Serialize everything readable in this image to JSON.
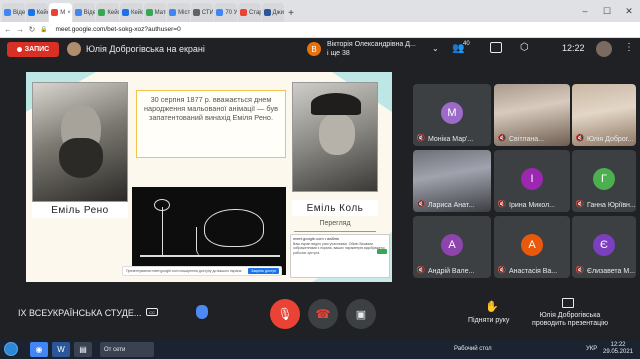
{
  "browser": {
    "tabs": [
      {
        "label": "Відео",
        "color": "#4285f4"
      },
      {
        "label": "Кейс",
        "color": "#1a73e8"
      },
      {
        "label": "M",
        "color": "#ea4335",
        "active": true
      },
      {
        "label": "Відео",
        "color": "#4285f4"
      },
      {
        "label": "Кейс",
        "color": "#34a853"
      },
      {
        "label": "Кейс",
        "color": "#1a73e8"
      },
      {
        "label": "Мате",
        "color": "#34a853"
      },
      {
        "label": "Місті",
        "color": "#4285f4"
      },
      {
        "label": "СТИ",
        "color": "#5f6368"
      },
      {
        "label": "70 У",
        "color": "#4285f4"
      },
      {
        "label": "Старі",
        "color": "#ea4335"
      },
      {
        "label": "Джи",
        "color": "#2b579a"
      }
    ],
    "url": "meet.google.com/bet-sokg-xoz?authuser=0"
  },
  "meet_header": {
    "recording_label": "ЗАПИС",
    "presenter_title": "Юлія Доброгівська на екрані",
    "notification_initial": "В",
    "notification_line1": "Вікторія Олександрівна Д...",
    "notification_line2": "і ще 38",
    "people_count": "40",
    "clock": "12:22"
  },
  "slide": {
    "quote": "30 серпня 1877 р. вважається днем народження мальованої анімації — був запатентований винахід Еміля Рено.",
    "name_left": "Еміль Рено",
    "name_right": "Еміль Коль",
    "permit_label": "Перегляд",
    "popup_title": "meet.google.com • ваблю",
    "popup_text": "Ваш екран видно усім учасникам. Обмін Вашими зображеннями з екрана, ваших параметрів відображено рабочих зустрічі.",
    "share_text": "Презентування meet.google.com поширення доступу до вашого екрана.",
    "share_button": "Закрить доступ"
  },
  "participants": [
    {
      "name": "Моніка Мар'...",
      "initial": "M",
      "color": "#9c6bc9"
    },
    {
      "name": "Світлана...",
      "video": true
    },
    {
      "name": "Юлія Доброг...",
      "video": true
    },
    {
      "name": "Лариса Анат...",
      "video": true
    },
    {
      "name": "Ірина Микол...",
      "initial": "I",
      "color": "#9c27b0"
    },
    {
      "name": "Ганна Юріївн...",
      "initial": "Г",
      "color": "#4caf50"
    },
    {
      "name": "Андрій Вале...",
      "initial": "A",
      "color": "#8e44ad"
    },
    {
      "name": "Анастасія Ва...",
      "initial": "A",
      "color": "#e8590c"
    },
    {
      "name": "Єлизавета М...",
      "initial": "Є",
      "color": "#7b3fbf"
    }
  ],
  "bottom_bar": {
    "meeting_name": "IX ВСЕУКРАЇНСЬКА СТУДЕ...",
    "raise_hand_label": "Підняти руку",
    "presenting_line1": "Юлія Доброгівська",
    "presenting_line2": "проводить презентацію"
  },
  "taskbar": {
    "offline_label": "От сети",
    "desktop_label": "Рабочий стол",
    "lang": "УКР",
    "time": "12:22",
    "date": "29.05.2021"
  },
  "colors": {
    "meet_bg": "#202124",
    "tile_bg": "#3c4043",
    "record_red": "#d93025",
    "slide_bg": "#fdf8ee",
    "slide_accent": "#bde7e4"
  }
}
